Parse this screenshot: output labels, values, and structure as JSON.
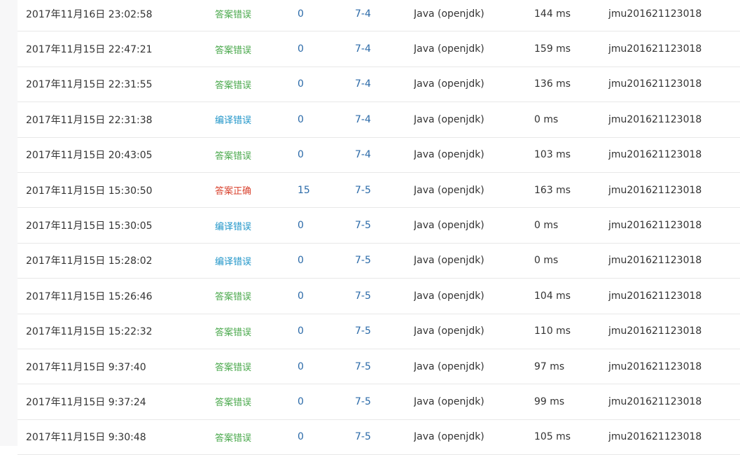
{
  "colors": {
    "wrong_answer": "#49a84b",
    "compile_error": "#2196c9",
    "accepted": "#d9432f",
    "link": "#2b6aa8"
  },
  "submissions": [
    {
      "time": "2017年11月16日 23:02:58",
      "status": "答案错误",
      "status_type": "wrong",
      "score": "0",
      "problem": "7-4",
      "language": "Java (openjdk)",
      "runtime": "144 ms",
      "user": "jmu201621123018"
    },
    {
      "time": "2017年11月15日 22:47:21",
      "status": "答案错误",
      "status_type": "wrong",
      "score": "0",
      "problem": "7-4",
      "language": "Java (openjdk)",
      "runtime": "159 ms",
      "user": "jmu201621123018"
    },
    {
      "time": "2017年11月15日 22:31:55",
      "status": "答案错误",
      "status_type": "wrong",
      "score": "0",
      "problem": "7-4",
      "language": "Java (openjdk)",
      "runtime": "136 ms",
      "user": "jmu201621123018"
    },
    {
      "time": "2017年11月15日 22:31:38",
      "status": "编译错误",
      "status_type": "compile",
      "score": "0",
      "problem": "7-4",
      "language": "Java (openjdk)",
      "runtime": "0 ms",
      "user": "jmu201621123018"
    },
    {
      "time": "2017年11月15日 20:43:05",
      "status": "答案错误",
      "status_type": "wrong",
      "score": "0",
      "problem": "7-4",
      "language": "Java (openjdk)",
      "runtime": "103 ms",
      "user": "jmu201621123018"
    },
    {
      "time": "2017年11月15日 15:30:50",
      "status": "答案正确",
      "status_type": "correct",
      "score": "15",
      "problem": "7-5",
      "language": "Java (openjdk)",
      "runtime": "163 ms",
      "user": "jmu201621123018"
    },
    {
      "time": "2017年11月15日 15:30:05",
      "status": "编译错误",
      "status_type": "compile",
      "score": "0",
      "problem": "7-5",
      "language": "Java (openjdk)",
      "runtime": "0 ms",
      "user": "jmu201621123018"
    },
    {
      "time": "2017年11月15日 15:28:02",
      "status": "编译错误",
      "status_type": "compile",
      "score": "0",
      "problem": "7-5",
      "language": "Java (openjdk)",
      "runtime": "0 ms",
      "user": "jmu201621123018"
    },
    {
      "time": "2017年11月15日 15:26:46",
      "status": "答案错误",
      "status_type": "wrong",
      "score": "0",
      "problem": "7-5",
      "language": "Java (openjdk)",
      "runtime": "104 ms",
      "user": "jmu201621123018"
    },
    {
      "time": "2017年11月15日 15:22:32",
      "status": "答案错误",
      "status_type": "wrong",
      "score": "0",
      "problem": "7-5",
      "language": "Java (openjdk)",
      "runtime": "110 ms",
      "user": "jmu201621123018"
    },
    {
      "time": "2017年11月15日 9:37:40",
      "status": "答案错误",
      "status_type": "wrong",
      "score": "0",
      "problem": "7-5",
      "language": "Java (openjdk)",
      "runtime": "97 ms",
      "user": "jmu201621123018"
    },
    {
      "time": "2017年11月15日 9:37:24",
      "status": "答案错误",
      "status_type": "wrong",
      "score": "0",
      "problem": "7-5",
      "language": "Java (openjdk)",
      "runtime": "99 ms",
      "user": "jmu201621123018"
    },
    {
      "time": "2017年11月15日 9:30:48",
      "status": "答案错误",
      "status_type": "wrong",
      "score": "0",
      "problem": "7-5",
      "language": "Java (openjdk)",
      "runtime": "105 ms",
      "user": "jmu201621123018"
    }
  ]
}
